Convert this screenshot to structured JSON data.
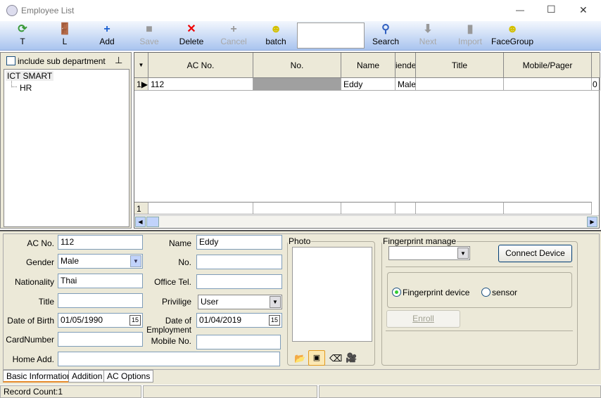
{
  "window": {
    "title": "Employee List",
    "minimize": "—",
    "maximize": "☐",
    "close": "✕"
  },
  "toolbar": {
    "items": [
      {
        "label": "T",
        "icon": "refresh-icon",
        "glyph": "⟳",
        "color": "#3a9a3a",
        "disabled": false
      },
      {
        "label": "L",
        "icon": "exit-door-icon",
        "glyph": "🚪",
        "color": "#d00",
        "disabled": false
      },
      {
        "label": "Add",
        "icon": "plus-icon",
        "glyph": "+",
        "color": "#1a5fd0",
        "disabled": false
      },
      {
        "label": "Save",
        "icon": "save-icon",
        "glyph": "■",
        "color": "#999",
        "disabled": true
      },
      {
        "label": "Delete",
        "icon": "x-icon",
        "glyph": "✕",
        "color": "#e00",
        "disabled": false
      },
      {
        "label": "Cancel",
        "icon": "plus-gray-icon",
        "glyph": "+",
        "color": "#999",
        "disabled": true
      },
      {
        "label": "batch",
        "icon": "people-icon",
        "glyph": "☻",
        "color": "#d4c000",
        "disabled": false
      }
    ],
    "search_value": "",
    "items2": [
      {
        "label": "Search",
        "icon": "search-icon",
        "glyph": "⚲",
        "color": "#3060c0",
        "disabled": false
      },
      {
        "label": "Next",
        "icon": "down-arrow-icon",
        "glyph": "⬇",
        "color": "#999",
        "disabled": true
      },
      {
        "label": "Import",
        "icon": "import-icon",
        "glyph": "▮",
        "color": "#999",
        "disabled": true
      },
      {
        "label": "FaceGroup",
        "icon": "people-icon",
        "glyph": "☻",
        "color": "#d4c000",
        "disabled": false
      }
    ]
  },
  "left": {
    "include_sub_department": "include sub department",
    "checked": false,
    "tree": [
      "ICT SMART",
      "HR"
    ]
  },
  "grid": {
    "columns": [
      "AC No.",
      "No.",
      "Name",
      "iende",
      "Title",
      "Mobile/Pager"
    ],
    "rows": [
      {
        "indicator": "1",
        "cells": [
          "112",
          "",
          "Eddy",
          "Male",
          "",
          "",
          "0"
        ]
      }
    ],
    "footer_indicator": "1"
  },
  "form": {
    "ac_no": {
      "label": "AC No.",
      "value": "112"
    },
    "gender": {
      "label": "Gender",
      "value": "Male"
    },
    "nationality": {
      "label": "Nationality",
      "value": "Thai"
    },
    "title": {
      "label": "Title",
      "value": ""
    },
    "dob": {
      "label": "Date of Birth",
      "value": "01/05/1990"
    },
    "card": {
      "label": "CardNumber",
      "value": ""
    },
    "home": {
      "label": "Home Add.",
      "value": ""
    },
    "name": {
      "label": "Name",
      "value": "Eddy"
    },
    "no": {
      "label": "No.",
      "value": ""
    },
    "office": {
      "label": "Office Tel.",
      "value": ""
    },
    "privilege": {
      "label": "Privilige",
      "value": "User"
    },
    "doe": {
      "label": "Date of Employment",
      "value": "01/04/2019"
    },
    "mobile": {
      "label": "Mobile No.",
      "value": ""
    }
  },
  "photo": {
    "label": "Photo"
  },
  "fingerprint": {
    "label": "Fingerprint manage",
    "select_value": "",
    "connect": "Connect Device",
    "radio1": "Fingerprint device",
    "radio2": "sensor",
    "selected": "Fingerprint device",
    "enroll": "Enroll"
  },
  "tabs": [
    "Basic Information",
    "Addition",
    "AC Options"
  ],
  "active_tab": "Basic Information",
  "status": {
    "record_count": "Record Count:1"
  }
}
